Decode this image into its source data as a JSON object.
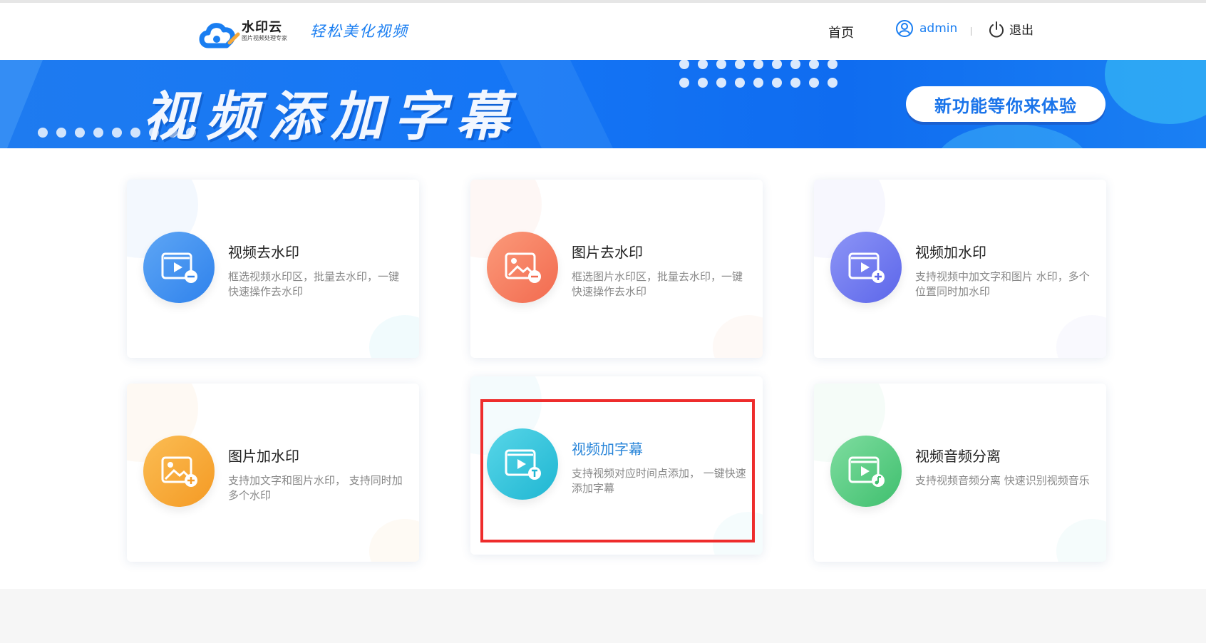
{
  "header": {
    "logo_name": "水印云",
    "logo_subtitle": "图片视频处理专家",
    "slogan": "轻松美化视频",
    "nav": {
      "home": "首页",
      "user": "admin",
      "logout": "退出"
    }
  },
  "banner": {
    "title": "视频添加字幕",
    "button": "新功能等你来体验"
  },
  "cards": [
    {
      "title": "视频去水印",
      "desc": "框选视频水印区，批量去水印，一键快速操作去水印",
      "icon": "video-minus-icon",
      "color": "#3f8ff0"
    },
    {
      "title": "图片去水印",
      "desc": "框选图片水印区，批量去水印，一键快速操作去水印",
      "icon": "image-minus-icon",
      "color": "#f5755a"
    },
    {
      "title": "视频加水印",
      "desc": "支持视频中加文字和图片 水印，多个位置同时加水印",
      "icon": "video-plus-icon",
      "color": "#6f79f0"
    },
    {
      "title": "图片加水印",
      "desc": "支持加文字和图片水印， 支持同时加多个水印",
      "icon": "image-plus-icon",
      "color": "#f6a93b"
    },
    {
      "title": "视频加字幕",
      "desc": "支持视频对应时间点添加， 一键快速添加字幕",
      "icon": "video-text-icon",
      "color": "#32c6dd"
    },
    {
      "title": "视频音频分离",
      "desc": "支持视频音频分离 快速识别视频音乐",
      "icon": "video-music-icon",
      "color": "#56cc85"
    }
  ],
  "colors": {
    "accent": "#1a7ef1",
    "highlight": "#ee2c2c"
  }
}
